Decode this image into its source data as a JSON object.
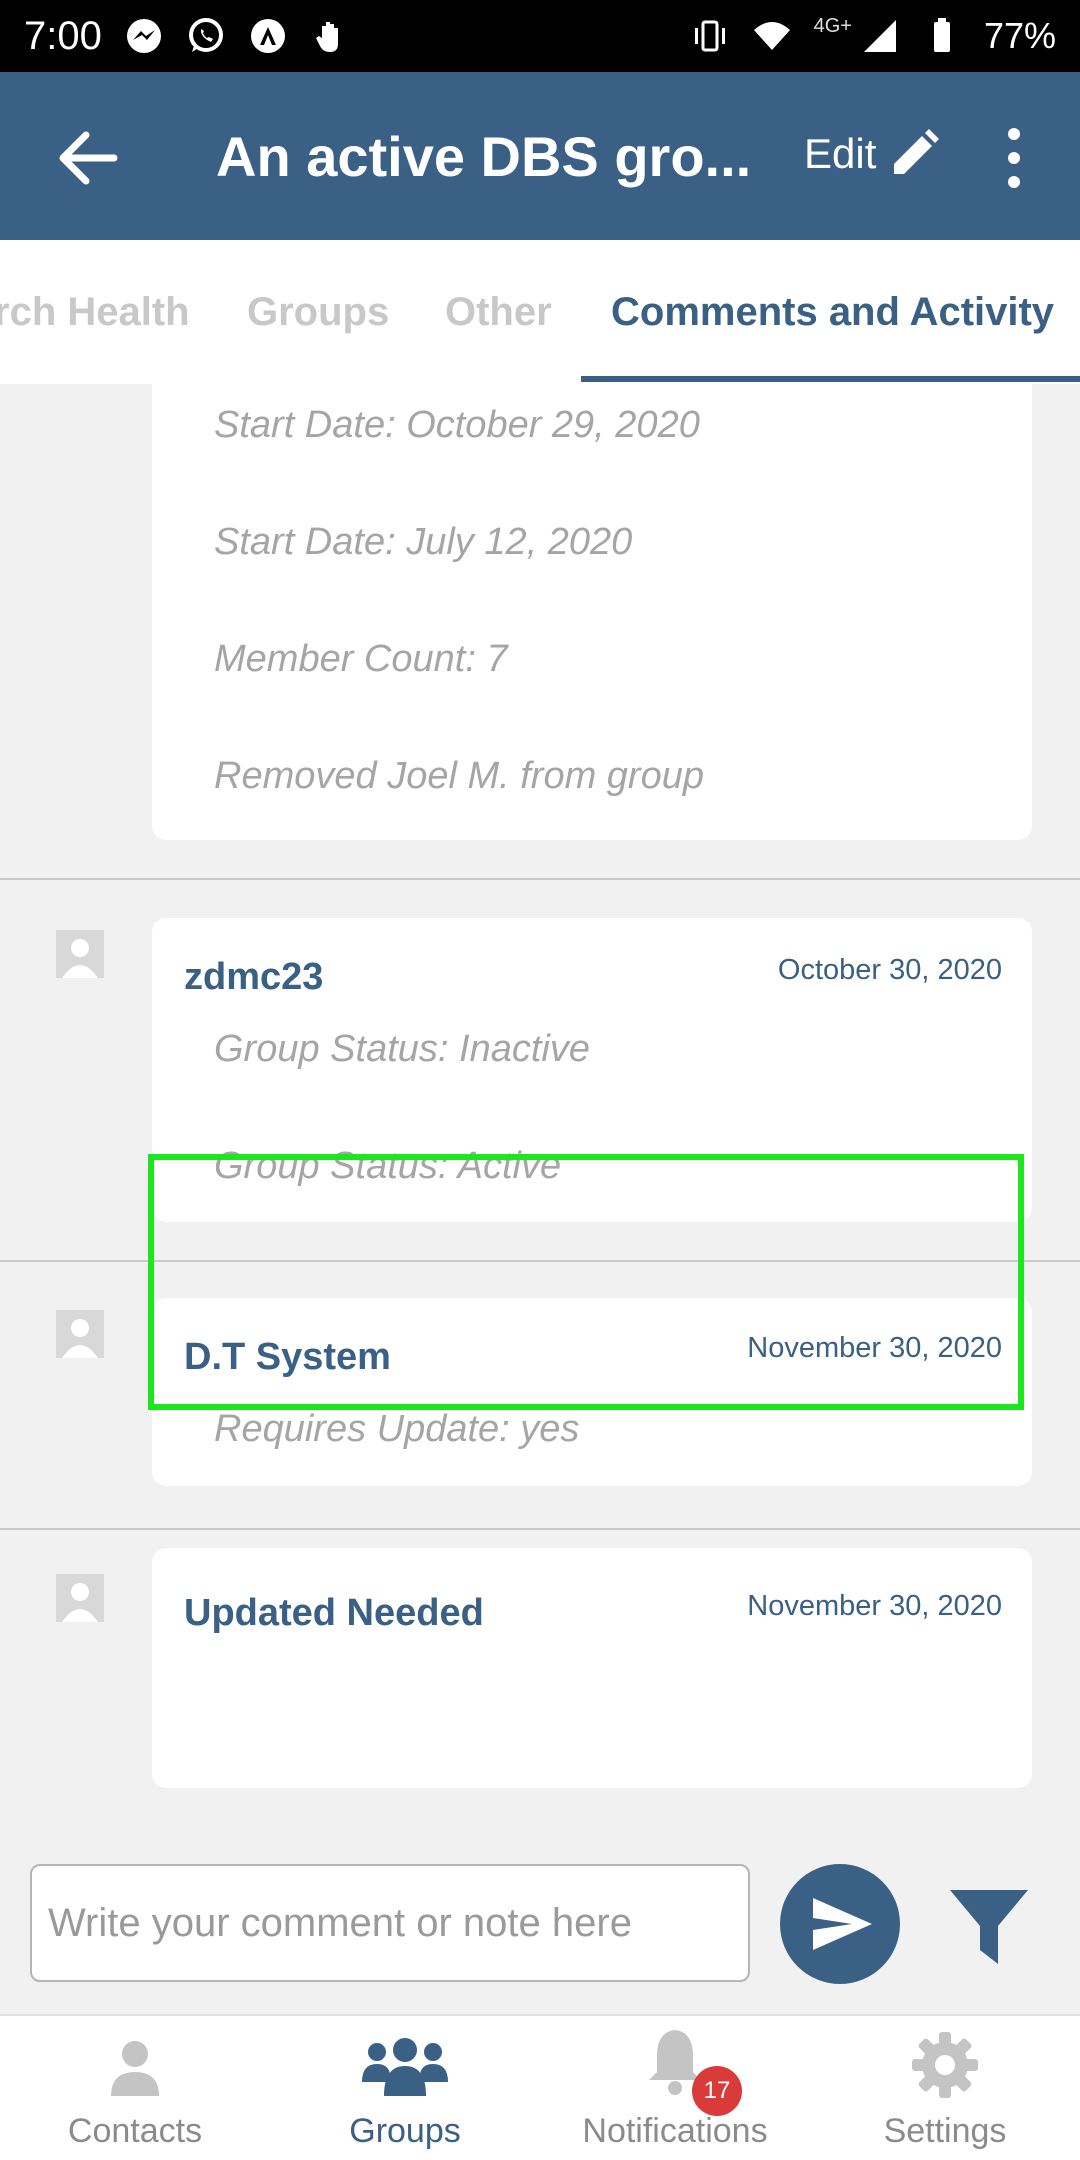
{
  "status_bar": {
    "time": "7:00",
    "network": "4G+",
    "battery": "77%",
    "icons": [
      "messenger-icon",
      "whatsapp-icon",
      "app-a-icon",
      "hand-icon",
      "vibrate-icon",
      "wifi-icon",
      "signal-icon",
      "battery-icon"
    ]
  },
  "app_bar": {
    "title": "An active DBS gro...",
    "edit_label": "Edit"
  },
  "tabs": [
    {
      "label": "rch Health",
      "active": false
    },
    {
      "label": "Groups",
      "active": false
    },
    {
      "label": "Other",
      "active": false
    },
    {
      "label": "Comments and Activity",
      "active": true
    }
  ],
  "entries": [
    {
      "author": "",
      "date": "",
      "lines": [
        "Start Date: October 29, 2020",
        "Start Date: July 12, 2020",
        "Member Count: 7",
        "Removed Joel M. from group"
      ]
    },
    {
      "author": "zdmc23",
      "date": "October 30, 2020",
      "lines": [
        "Group Status: Inactive",
        "Group Status: Active"
      ]
    },
    {
      "author": "D.T System",
      "date": "November 30, 2020",
      "lines": [
        "Requires Update: yes"
      ]
    },
    {
      "author": "Updated Needed",
      "date": "November 30, 2020",
      "lines": []
    }
  ],
  "comment": {
    "placeholder": "Write your comment or note here",
    "value": ""
  },
  "bottom_nav": [
    {
      "label": "Contacts",
      "icon": "person-icon",
      "active": false
    },
    {
      "label": "Groups",
      "icon": "groups-icon",
      "active": true
    },
    {
      "label": "Notifications",
      "icon": "bell-icon",
      "active": false,
      "badge": "17"
    },
    {
      "label": "Settings",
      "icon": "gear-icon",
      "active": false
    }
  ],
  "colors": {
    "primary": "#3a6086",
    "highlight": "#1ee61e",
    "badge": "#d93a3a"
  }
}
